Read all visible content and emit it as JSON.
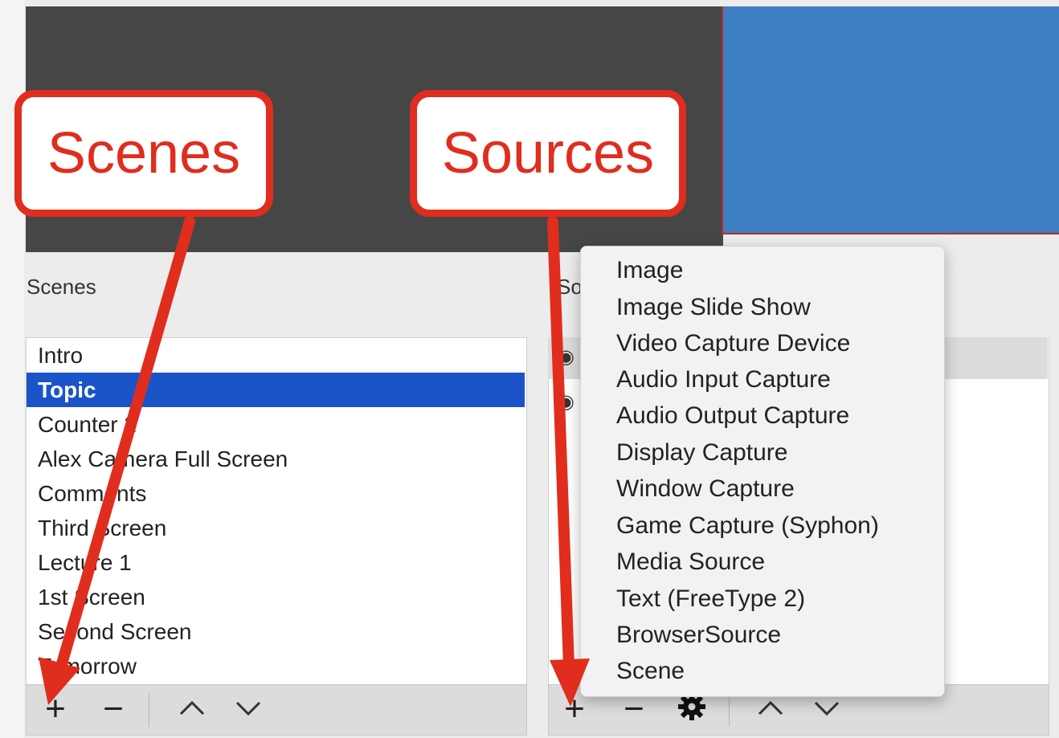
{
  "callouts": {
    "scenes": "Scenes",
    "sources": "Sources"
  },
  "scenes_panel": {
    "title": "Scenes",
    "items": [
      "Intro",
      "Topic",
      "Counter 2",
      "Alex Camera Full Screen",
      "Comments",
      "Third Screen",
      "Lecture 1",
      "1st Screen",
      "Second Screen",
      "Tomorrow"
    ],
    "selected": "Topic"
  },
  "sources_panel": {
    "title": "So"
  },
  "source_type_menu": {
    "items": [
      "Image",
      "Image Slide Show",
      "Video Capture Device",
      "Audio Input Capture",
      "Audio Output Capture",
      "Display Capture",
      "Window Capture",
      "Game Capture (Syphon)",
      "Media Source",
      "Text (FreeType 2)",
      "BrowserSource",
      "Scene"
    ]
  },
  "toolbar_icons": {
    "add": "+",
    "remove": "−",
    "up": "^",
    "down": "v",
    "settings": "gear-icon"
  },
  "colors": {
    "accent": "#e02d1d",
    "selection": "#1b54c8",
    "preview_blue": "#3e7ec2"
  }
}
